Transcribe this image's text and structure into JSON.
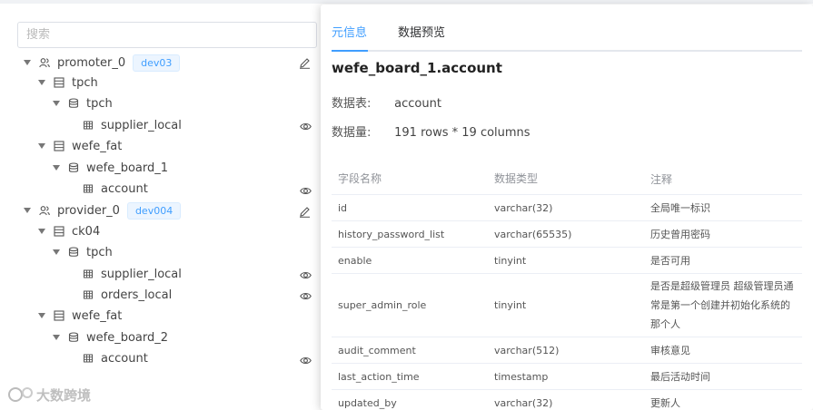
{
  "search": {
    "placeholder": "搜索"
  },
  "tree": {
    "promoter": {
      "label": "promoter_0",
      "tag": "dev03"
    },
    "tpch_db1": {
      "label": "tpch"
    },
    "tpch_schema1": {
      "label": "tpch"
    },
    "supplier_local_1": {
      "label": "supplier_local"
    },
    "wefe_fat_1": {
      "label": "wefe_fat"
    },
    "wefe_board_1": {
      "label": "wefe_board_1"
    },
    "account_1": {
      "label": "account"
    },
    "provider": {
      "label": "provider_0",
      "tag": "dev004"
    },
    "ck04": {
      "label": "ck04"
    },
    "tpch_schema2": {
      "label": "tpch"
    },
    "supplier_local_2": {
      "label": "supplier_local"
    },
    "orders_local": {
      "label": "orders_local"
    },
    "wefe_fat_2": {
      "label": "wefe_fat"
    },
    "wefe_board_2": {
      "label": "wefe_board_2"
    },
    "account_2": {
      "label": "account"
    }
  },
  "panel": {
    "tabs": [
      "元信息",
      "数据预览"
    ],
    "title": "wefe_board_1.account",
    "table_label": "数据表:",
    "table_value": "account",
    "size_label": "数据量:",
    "size_value": "191 rows * 19 columns",
    "columns": [
      "字段名称",
      "数据类型",
      "注释"
    ],
    "rows": [
      {
        "name": "id",
        "type": "varchar(32)",
        "comment": "全局唯一标识"
      },
      {
        "name": "history_password_list",
        "type": "varchar(65535)",
        "comment": "历史曾用密码"
      },
      {
        "name": "enable",
        "type": "tinyint",
        "comment": "是否可用"
      },
      {
        "name": "super_admin_role",
        "type": "tinyint",
        "comment": "是否是超级管理员 超级管理员通常是第一个创建并初始化系统的那个人"
      },
      {
        "name": "audit_comment",
        "type": "varchar(512)",
        "comment": "审核意见"
      },
      {
        "name": "last_action_time",
        "type": "timestamp",
        "comment": "最后活动时间"
      },
      {
        "name": "updated_by",
        "type": "varchar(32)",
        "comment": "更新人"
      }
    ]
  },
  "watermark": {
    "text": "大数跨境"
  },
  "colors": {
    "accent": "#409eff",
    "tag_bg": "#ecf5ff",
    "border": "#dcdfe6"
  }
}
